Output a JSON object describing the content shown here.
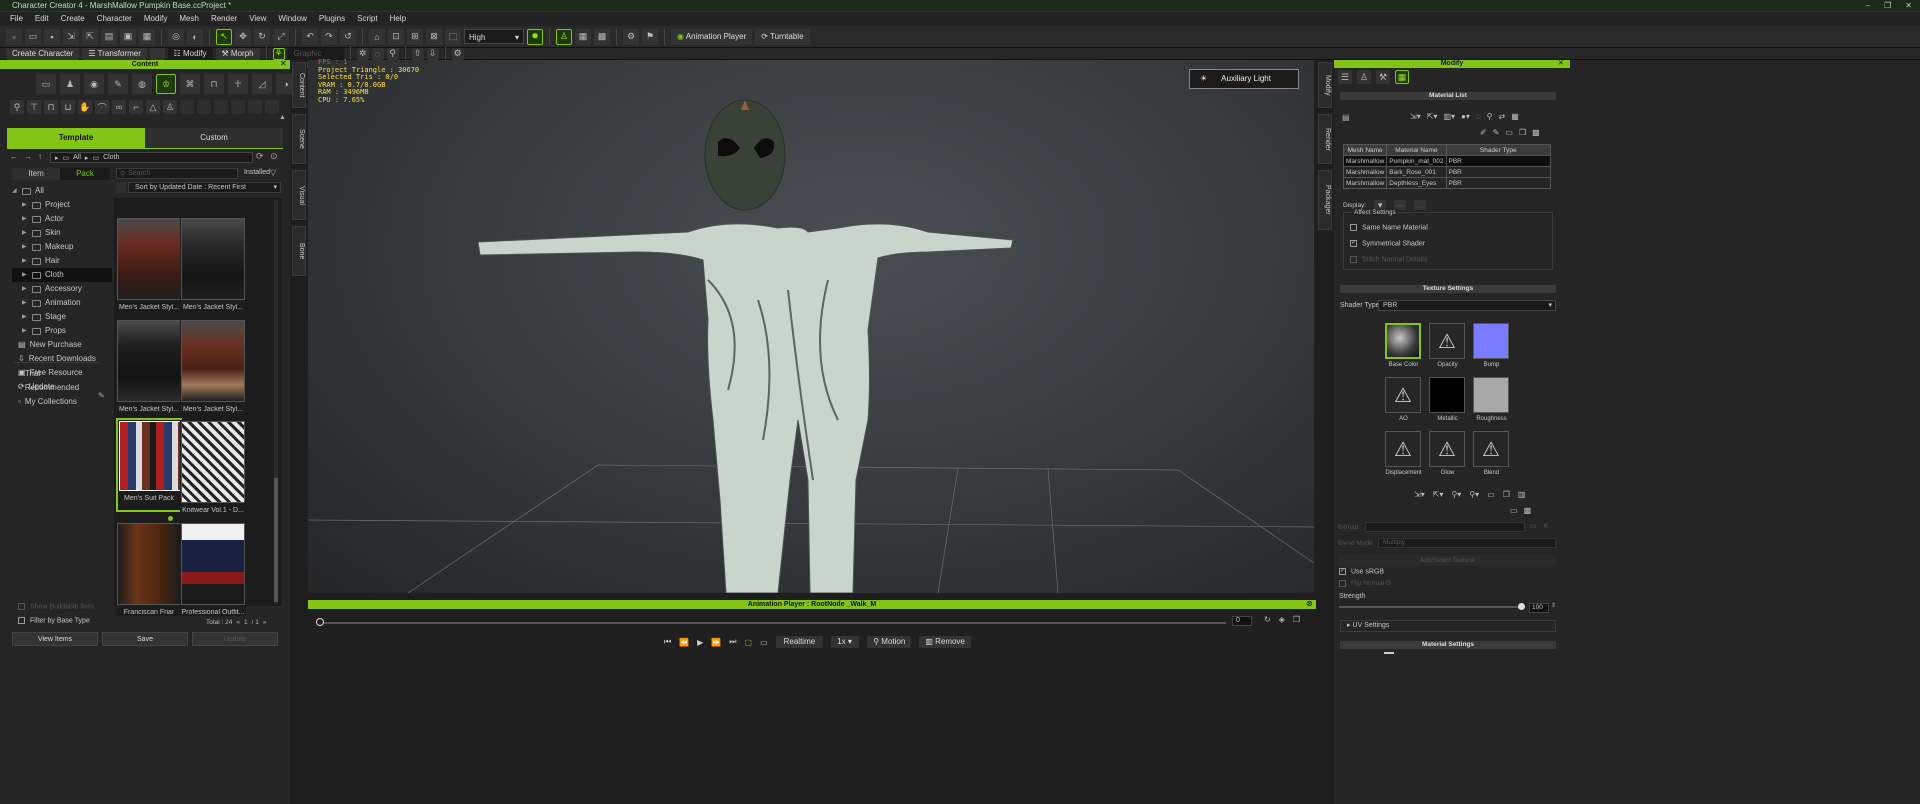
{
  "window": {
    "title": "Character Creator 4 - MarshMallow Pumpkin Base.ccProject *"
  },
  "menu": [
    "File",
    "Edit",
    "Create",
    "Character",
    "Modify",
    "Mesh",
    "Render",
    "View",
    "Window",
    "Plugins",
    "Script",
    "Help"
  ],
  "toolbar1": {
    "quality": "High",
    "animation_player": "Animation Player",
    "turntable": "Turntable"
  },
  "toolbar2": {
    "create_character": "Create Character",
    "transformer": "Transformer",
    "modify": "Modify",
    "morph": "Morph",
    "search_placeholder": "Graphic Options"
  },
  "content": {
    "title": "Content",
    "tabs": {
      "template": "Template",
      "custom": "Custom"
    },
    "breadcrumb": {
      "all": "All",
      "cloth": "Cloth"
    },
    "subtabs": {
      "item": "Item",
      "pack": "Pack"
    },
    "search_placeholder": "Search",
    "installed": "Installed",
    "sort": "Sort by Updated Date : Recent First",
    "tree": [
      {
        "label": "All",
        "expanded": true
      },
      {
        "label": "Project"
      },
      {
        "label": "Actor"
      },
      {
        "label": "Skin"
      },
      {
        "label": "Makeup"
      },
      {
        "label": "Hair"
      },
      {
        "label": "Cloth",
        "selected": true
      },
      {
        "label": "Accessory"
      },
      {
        "label": "Animation"
      },
      {
        "label": "Stage"
      },
      {
        "label": "Props"
      },
      {
        "label": "New Purchase"
      },
      {
        "label": "Recent Downloads"
      },
      {
        "label": "Free Resource"
      },
      {
        "label": "Update"
      }
    ],
    "tree2": [
      "Trial",
      "Recommended",
      "My Collections"
    ],
    "items": [
      {
        "label": "Men's Jacket Styl..."
      },
      {
        "label": "Men's Jacket Styl..."
      },
      {
        "label": "Men's Jacket Styl..."
      },
      {
        "label": "Men's Jacket Styl..."
      },
      {
        "label": "Men's Suit Pack"
      },
      {
        "label": "Knitwear Vol.1 - D..."
      },
      {
        "label": "Franciscan Friar"
      },
      {
        "label": "Professional Outfit..."
      }
    ],
    "show_buildable": "Show Buildable Item",
    "filter_base": "Filter by Base Type",
    "total": "Total : 24",
    "page": "1",
    "pages": "/ 1",
    "buttons": {
      "view_items": "View Items",
      "save": "Save",
      "update": "Update"
    }
  },
  "side_tabs": [
    "Content",
    "Scene",
    "Visual",
    "Bone"
  ],
  "viewport": {
    "stats": [
      "FPS : 1",
      "Project Triangle : 30670",
      "Selected Tris : 0/0",
      "VRAM : 0.7/8.0GB",
      "RAM : 3496MB",
      "CPU : 7.65%"
    ],
    "aux_light": "Auxiliary Light"
  },
  "anim": {
    "title": "Animation Player : RootNode _Walk_M",
    "frame": "0",
    "realtime": "Realtime",
    "speed": "1x",
    "motion": "Motion",
    "remove": "Remove"
  },
  "right_tabs": [
    "Modify",
    "Render",
    "Packager"
  ],
  "modify": {
    "title": "Modify",
    "material_list": "Material List",
    "columns": [
      "Mesh Name",
      "Material Name",
      "Shader Type"
    ],
    "rows": [
      [
        "Marshmallow",
        "Pumpkin_mat_002",
        "PBR"
      ],
      [
        "Marshmallow",
        "Bark_Rose_001",
        "PBR"
      ],
      [
        "Marshmallow",
        "Depthless_Eyes",
        "PBR"
      ]
    ],
    "display": "Display:",
    "affect_settings": "Affect Settings",
    "same_name": "Same Name Material",
    "symmetrical": "Symmetrical Shader",
    "stitch": "Stitch Normal Details",
    "texture_settings": "Texture Settings",
    "shader_type_label": "Shader Type :",
    "shader_type": "PBR",
    "textures": [
      "Base Color",
      "Opacity",
      "Bump",
      "AO",
      "Metallic",
      "Roughness",
      "Displacement",
      "Glow",
      "Blend"
    ],
    "texture_colors": {
      "bump": "#7b7bff",
      "metallic": "#000000",
      "roughness": "#a8a8a8"
    },
    "bitmap": "Bitmap:",
    "blend_mode": "Blend Mode",
    "blend_value": "Multiply",
    "add_select": "Add/Select Texture",
    "use_srgb": "Use sRGB",
    "flip": "Flip Normal G",
    "strength": "Strength",
    "strength_value": "100",
    "uv_settings": "UV Settings",
    "material_settings": "Material Settings"
  }
}
